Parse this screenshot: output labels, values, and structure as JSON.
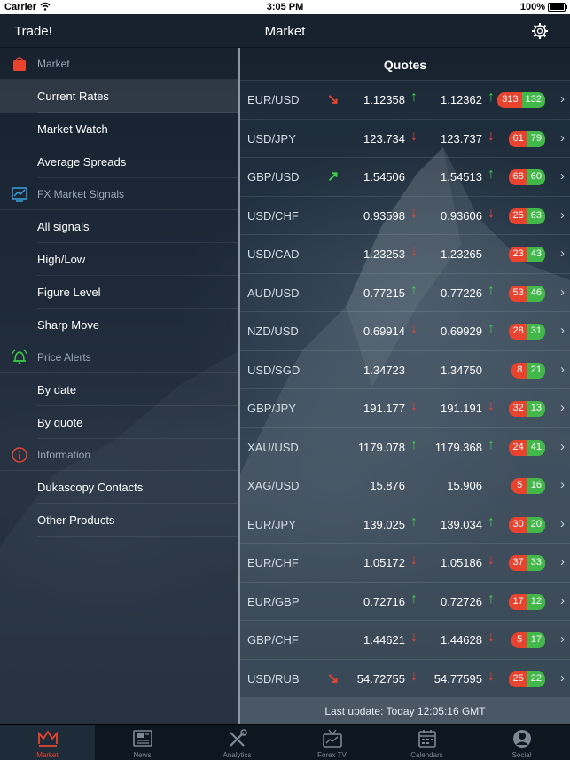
{
  "status_bar": {
    "carrier": "Carrier",
    "time": "3:05 PM",
    "battery": "100%"
  },
  "navbar": {
    "left_title": "Trade!",
    "title": "Market"
  },
  "sidebar": {
    "sections": [
      {
        "label": "Market",
        "icon": "shopping-bag-icon",
        "items": [
          "Current Rates",
          "Market Watch",
          "Average Spreads"
        ]
      },
      {
        "label": "FX Market Signals",
        "icon": "chart-icon",
        "items": [
          "All signals",
          "High/Low",
          "Figure Level",
          "Sharp Move"
        ]
      },
      {
        "label": "Price Alerts",
        "icon": "alarm-bell-icon",
        "items": [
          "By date",
          "By quote"
        ]
      },
      {
        "label": "Information",
        "icon": "info-icon",
        "items": [
          "Dukascopy Contacts",
          "Other Products"
        ]
      }
    ],
    "active_item": "Current Rates"
  },
  "quotes": {
    "header": "Quotes",
    "rows": [
      {
        "pair": "EUR/USD",
        "trend": "down",
        "bid": "1.12358",
        "bid_dir": "up",
        "ask": "1.12362",
        "ask_dir": "up",
        "sell": "313",
        "buy": "132"
      },
      {
        "pair": "USD/JPY",
        "trend": "",
        "bid": "123.734",
        "bid_dir": "down",
        "ask": "123.737",
        "ask_dir": "down",
        "sell": "61",
        "buy": "79"
      },
      {
        "pair": "GBP/USD",
        "trend": "up",
        "bid": "1.54506",
        "bid_dir": "",
        "ask": "1.54513",
        "ask_dir": "up",
        "sell": "68",
        "buy": "60"
      },
      {
        "pair": "USD/CHF",
        "trend": "",
        "bid": "0.93598",
        "bid_dir": "down",
        "ask": "0.93606",
        "ask_dir": "down",
        "sell": "25",
        "buy": "63"
      },
      {
        "pair": "USD/CAD",
        "trend": "",
        "bid": "1.23253",
        "bid_dir": "down",
        "ask": "1.23265",
        "ask_dir": "",
        "sell": "23",
        "buy": "43"
      },
      {
        "pair": "AUD/USD",
        "trend": "",
        "bid": "0.77215",
        "bid_dir": "up",
        "ask": "0.77226",
        "ask_dir": "up",
        "sell": "53",
        "buy": "46"
      },
      {
        "pair": "NZD/USD",
        "trend": "",
        "bid": "0.69914",
        "bid_dir": "down",
        "ask": "0.69929",
        "ask_dir": "up",
        "sell": "28",
        "buy": "31"
      },
      {
        "pair": "USD/SGD",
        "trend": "",
        "bid": "1.34723",
        "bid_dir": "",
        "ask": "1.34750",
        "ask_dir": "",
        "sell": "8",
        "buy": "21"
      },
      {
        "pair": "GBP/JPY",
        "trend": "",
        "bid": "191.177",
        "bid_dir": "down",
        "ask": "191.191",
        "ask_dir": "down",
        "sell": "32",
        "buy": "13"
      },
      {
        "pair": "XAU/USD",
        "trend": "",
        "bid": "1179.078",
        "bid_dir": "up",
        "ask": "1179.368",
        "ask_dir": "up",
        "sell": "24",
        "buy": "41"
      },
      {
        "pair": "XAG/USD",
        "trend": "",
        "bid": "15.876",
        "bid_dir": "",
        "ask": "15.906",
        "ask_dir": "",
        "sell": "5",
        "buy": "16"
      },
      {
        "pair": "EUR/JPY",
        "trend": "",
        "bid": "139.025",
        "bid_dir": "up",
        "ask": "139.034",
        "ask_dir": "up",
        "sell": "30",
        "buy": "20"
      },
      {
        "pair": "EUR/CHF",
        "trend": "",
        "bid": "1.05172",
        "bid_dir": "down",
        "ask": "1.05186",
        "ask_dir": "down",
        "sell": "37",
        "buy": "33"
      },
      {
        "pair": "EUR/GBP",
        "trend": "",
        "bid": "0.72716",
        "bid_dir": "up",
        "ask": "0.72726",
        "ask_dir": "up",
        "sell": "17",
        "buy": "12"
      },
      {
        "pair": "GBP/CHF",
        "trend": "",
        "bid": "1.44621",
        "bid_dir": "down",
        "ask": "1.44628",
        "ask_dir": "down",
        "sell": "5",
        "buy": "17"
      },
      {
        "pair": "USD/RUB",
        "trend": "down",
        "bid": "54.72755",
        "bid_dir": "down",
        "ask": "54.77595",
        "ask_dir": "down",
        "sell": "25",
        "buy": "22"
      }
    ],
    "last_update": "Last update: Today 12:05:16 GMT"
  },
  "tabbar": {
    "tabs": [
      {
        "label": "Market",
        "icon": "market-crown-icon"
      },
      {
        "label": "News",
        "icon": "newspaper-icon"
      },
      {
        "label": "Analytics",
        "icon": "tools-icon"
      },
      {
        "label": "Forex TV",
        "icon": "tv-icon"
      },
      {
        "label": "Calendars",
        "icon": "calendar-icon"
      },
      {
        "label": "Social",
        "icon": "person-icon"
      }
    ],
    "active": "Market"
  },
  "colors": {
    "up": "#3ecf48",
    "down": "#e8432f",
    "sell_badge": "#e8432f",
    "buy_badge": "#43b84a",
    "accent": "#e8432f"
  }
}
